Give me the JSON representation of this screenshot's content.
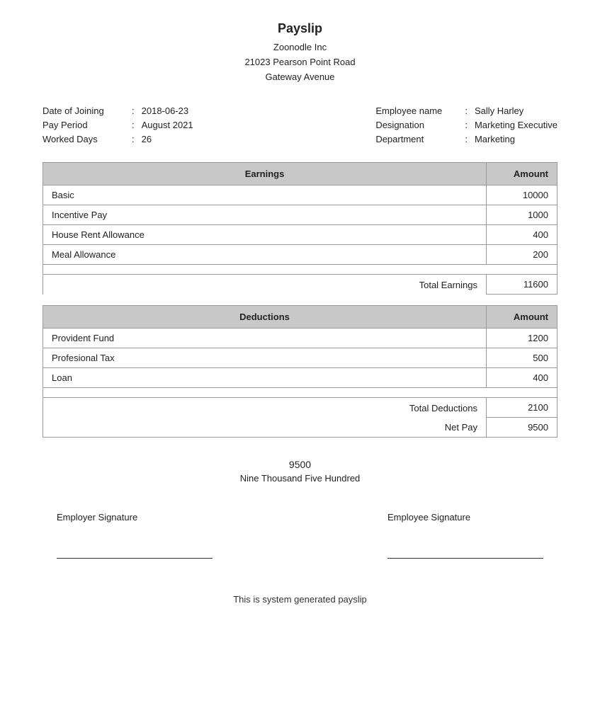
{
  "header": {
    "title": "Payslip",
    "company_name": "Zoonodle Inc",
    "address_line1": "21023 Pearson Point Road",
    "address_line2": "Gateway Avenue"
  },
  "employee_info": {
    "left": [
      {
        "label": "Date of Joining",
        "value": "2018-06-23"
      },
      {
        "label": "Pay Period",
        "value": "August 2021"
      },
      {
        "label": "Worked Days",
        "value": "26"
      }
    ],
    "right": [
      {
        "label": "Employee name",
        "value": "Sally Harley"
      },
      {
        "label": "Designation",
        "value": "Marketing Executive"
      },
      {
        "label": "Department",
        "value": "Marketing"
      }
    ]
  },
  "earnings": {
    "section_title": "Earnings",
    "amount_col_header": "Amount",
    "items": [
      {
        "name": "Basic",
        "amount": "10000"
      },
      {
        "name": "Incentive Pay",
        "amount": "1000"
      },
      {
        "name": "House Rent Allowance",
        "amount": "400"
      },
      {
        "name": "Meal Allowance",
        "amount": "200"
      }
    ],
    "total_label": "Total Earnings",
    "total_value": "11600"
  },
  "deductions": {
    "section_title": "Deductions",
    "amount_col_header": "Amount",
    "items": [
      {
        "name": "Provident Fund",
        "amount": "1200"
      },
      {
        "name": "Profesional Tax",
        "amount": "500"
      },
      {
        "name": "Loan",
        "amount": "400"
      }
    ],
    "total_label": "Total Deductions",
    "total_value": "2100",
    "net_pay_label": "Net Pay",
    "net_pay_value": "9500"
  },
  "net_amount": {
    "number": "9500",
    "words": "Nine Thousand Five Hundred"
  },
  "signatures": {
    "employer_label": "Employer Signature",
    "employee_label": "Employee Signature"
  },
  "footer": {
    "text": "This is system generated payslip"
  }
}
